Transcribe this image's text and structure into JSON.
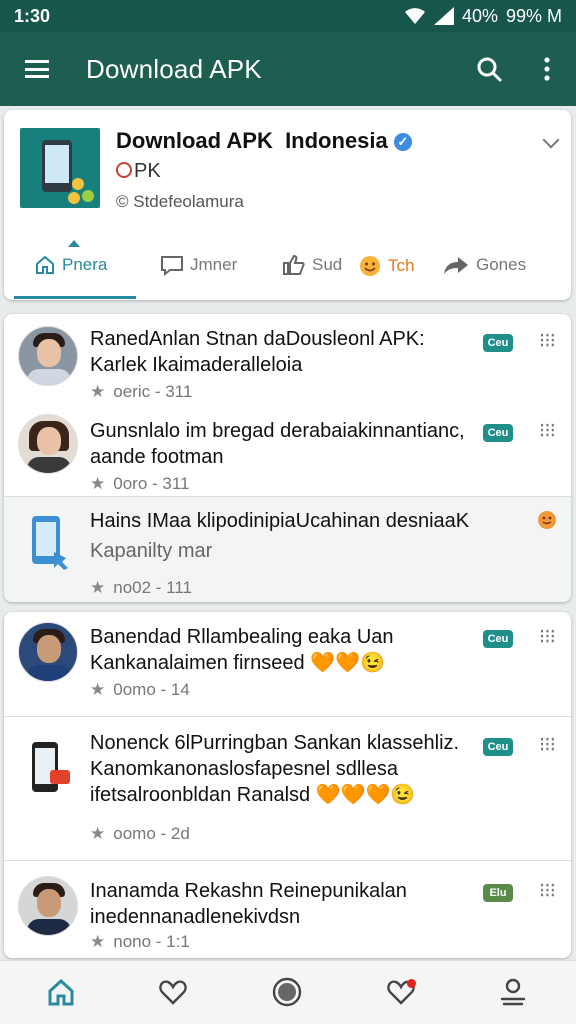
{
  "status_bar": {
    "time": "1:30",
    "battery": "40%",
    "data": "99% M"
  },
  "app_bar": {
    "title": "Download APK",
    "menu_icon": "hamburger-icon",
    "search_icon": "search-icon",
    "overflow_icon": "more-vert-icon"
  },
  "channel": {
    "name": "Download APK  Indonesia",
    "verified_icon": "verified-check-icon",
    "sub": "PK",
    "handle": "© Stdefeolamura",
    "tabs": [
      {
        "label": "Pnera",
        "icon": "home-icon"
      },
      {
        "label": "Jmner",
        "icon": "chat-icon"
      },
      {
        "label": "Sud",
        "icon": "thumb-icon"
      },
      {
        "label": "Tch",
        "icon": "emoji-icon"
      },
      {
        "label": "Gones",
        "icon": "share-icon"
      }
    ]
  },
  "posts": [
    {
      "title": "RanedAnlan Stnan daDousleonl APK:",
      "title2": "Karlek Ikaimaderalleloia",
      "meta": "oeric - 311",
      "badge": "Ceu"
    },
    {
      "title": "Gunsnlalo im bregad derabaiakinnantianc,",
      "title2": "aande footman",
      "meta": "0oro - 311",
      "badge": "Ceu"
    },
    {
      "title": "Hains IMaa klipodinipiaUcahinan desniaaK",
      "title2": "Kapanilty mar",
      "meta": "no02 - 111",
      "badge": ""
    },
    {
      "title": "Banendad Rllambealing eaka Uan",
      "title2": "Kankanalaimen firnseed 🧡🧡😉",
      "meta": "0omo - 14",
      "badge": "Ceu"
    },
    {
      "title": "Nonenck 6lPurringban Sankan klassehliz.",
      "title2": "Kanomkanonaslosfapesnel sdllesa",
      "title3": "ifetsalroonbldan Ranalsd 🧡🧡🧡😉",
      "meta": "oomo - 2d",
      "badge": "Ceu"
    },
    {
      "title": "Inanamda Rekashn Reinepunikalan",
      "title2": "inedennanadlenekivdsn",
      "meta": "nono - 1:1",
      "badge": "Elu"
    }
  ],
  "bottom_nav": [
    {
      "name": "home",
      "icon": "home-icon"
    },
    {
      "name": "favorites",
      "icon": "heart-icon"
    },
    {
      "name": "record",
      "icon": "circle-icon"
    },
    {
      "name": "notifications",
      "icon": "heart-notification-icon"
    },
    {
      "name": "profile",
      "icon": "profile-icon"
    }
  ],
  "colors": {
    "primary": "#1d5e50",
    "status_bar": "#17564a",
    "accent": "#2a8aa2",
    "badge": "#1f8f8a"
  }
}
